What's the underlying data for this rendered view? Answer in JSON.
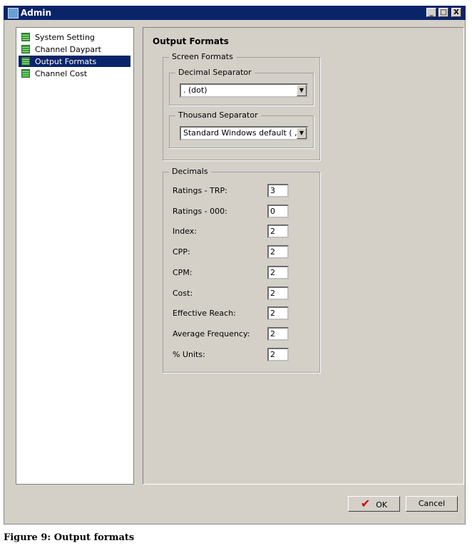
{
  "window": {
    "title": "Admin",
    "minimize": "_",
    "maximize": "□",
    "close": "X"
  },
  "tree": {
    "items": [
      {
        "label": "System Setting"
      },
      {
        "label": "Channel Daypart"
      },
      {
        "label": "Output Formats",
        "selected": true
      },
      {
        "label": "Channel Cost"
      }
    ]
  },
  "panel": {
    "title": "Output Formats",
    "screen_formats": {
      "label": "Screen Formats",
      "decimal_separator": {
        "label": "Decimal Separator",
        "value": ". (dot)"
      },
      "thousand_separator": {
        "label": "Thousand Separator",
        "value": "Standard Windows default ( , )"
      }
    },
    "decimals": {
      "label": "Decimals",
      "rows": [
        {
          "label": "Ratings - TRP:",
          "value": "3"
        },
        {
          "label": "Ratings - 000:",
          "value": "0"
        },
        {
          "label": "Index:",
          "value": "2"
        },
        {
          "label": "CPP:",
          "value": "2"
        },
        {
          "label": "CPM:",
          "value": "2"
        },
        {
          "label": "Cost:",
          "value": "2"
        },
        {
          "label": "Effective Reach:",
          "value": "2"
        },
        {
          "label": "Average Frequency:",
          "value": "2"
        },
        {
          "label": "% Units:",
          "value": "2"
        }
      ]
    }
  },
  "buttons": {
    "ok": "OK",
    "cancel": "Cancel"
  },
  "caption": "Figure 9: Output formats"
}
